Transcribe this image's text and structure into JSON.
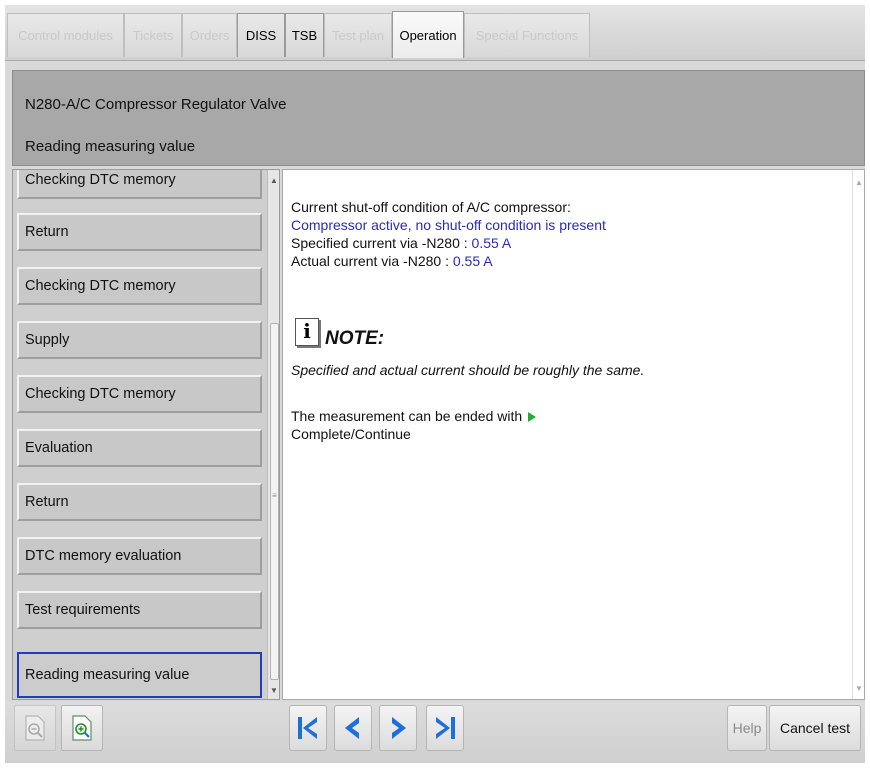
{
  "tabs": [
    {
      "label": "Control modules",
      "state": "disabled"
    },
    {
      "label": "Tickets",
      "state": "disabled"
    },
    {
      "label": "Orders",
      "state": "disabled"
    },
    {
      "label": "DISS",
      "state": "enabled"
    },
    {
      "label": "TSB",
      "state": "enabled"
    },
    {
      "label": "Test plan",
      "state": "disabled"
    },
    {
      "label": "Operation",
      "state": "selected"
    },
    {
      "label": "Special Functions",
      "state": "disabled"
    }
  ],
  "header": {
    "component": "N280-A/C Compressor Regulator Valve",
    "step": "Reading measuring value"
  },
  "steps": [
    "Checking DTC memory",
    "Return",
    "Checking DTC memory",
    "Supply",
    "Checking DTC memory",
    "Evaluation",
    "Return",
    "DTC memory evaluation",
    "Test requirements",
    "Reading measuring value"
  ],
  "selected_step": "Reading measuring value",
  "content": {
    "condition_label": "Current shut-off condition of A/C compressor:",
    "condition_value": "Compressor active, no shut-off condition is present",
    "specified_label": "Specified current via -N280 : ",
    "specified_value": "0.55  A",
    "actual_label": "Actual current via -N280 : ",
    "actual_value": "0.55  A",
    "note_icon": "i",
    "note_title": "NOTE:",
    "note_text": "Specified and actual current should be roughly the same.",
    "end_text": "The measurement can be ended with",
    "end_action": "Complete/Continue"
  },
  "toolbar": {
    "help_label": "Help",
    "cancel_label": "Cancel test"
  },
  "colors": {
    "value_blue": "#2a2ac0",
    "selected_border": "#1f3fb8",
    "nav_blue": "#1e6fd9",
    "play_green": "#29a83a"
  },
  "icons": [
    "zoom-out-icon",
    "zoom-in-icon",
    "first-icon",
    "previous-icon",
    "next-icon",
    "last-icon",
    "play-icon",
    "info-icon"
  ]
}
